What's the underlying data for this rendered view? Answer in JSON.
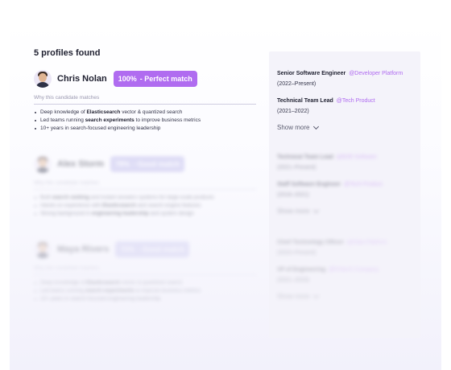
{
  "results": {
    "heading": "5 profiles found"
  },
  "profiles": [
    {
      "name": "Chris Nolan",
      "score": "100%",
      "match_label": "- Perfect match",
      "why_label": "Why this candidate matches",
      "bullets": [
        {
          "pre": "Deep knowledge of ",
          "bold": "Elasticsearch",
          "post": " vector & quantized search"
        },
        {
          "pre": "Led teams running ",
          "bold": "search experiments",
          "post": " to improve business metrics"
        },
        {
          "pre": "10+ years in search-focused engineering leadership",
          "bold": "",
          "post": ""
        }
      ]
    },
    {
      "name": "Alex Storm",
      "score": "78%",
      "match_label": "- Good match",
      "why_label": "Why this candidate matches",
      "bullets": [
        {
          "pre": "Built ",
          "bold": "search ranking",
          "post": " and instant answers systems for large-scale products"
        },
        {
          "pre": "Hands-on experience with ",
          "bold": "Elasticsearch",
          "post": " and search engine features"
        },
        {
          "pre": "Strong background in ",
          "bold": "engineering leadership",
          "post": " and system design"
        }
      ]
    },
    {
      "name": "Maya Rivers",
      "score": "72%",
      "match_label": "- Good match",
      "why_label": "Why this candidate matches",
      "bullets": [
        {
          "pre": "Deep knowledge of ",
          "bold": "Elasticsearch",
          "post": " vector & quantized search"
        },
        {
          "pre": "Led teams running ",
          "bold": "search experiments",
          "post": " to improve business metrics"
        },
        {
          "pre": "10+ years in search-focused engineering leadership",
          "bold": "",
          "post": ""
        }
      ]
    }
  ],
  "experience": [
    {
      "jobs": [
        {
          "title": "Senior Software Engineer",
          "org": "@Developer Platform",
          "years": "(2022–Present)"
        },
        {
          "title": "Technical Team Lead",
          "org": "@Tech Product",
          "years": "(2021–2022)"
        }
      ],
      "show_more": "Show more"
    },
    {
      "jobs": [
        {
          "title": "Technical Team Lead",
          "org": "@B2B Software",
          "years": "(2021–Present)"
        },
        {
          "title": "Staff Software Engineer",
          "org": "@Tech Product",
          "years": "(2018–2021)"
        }
      ],
      "show_more": "Show more"
    },
    {
      "jobs": [
        {
          "title": "Chief Technology Officer",
          "org": "@Data Platform",
          "years": "(2023–Present)"
        },
        {
          "title": "VP of Engineering",
          "org": "@Fintech Company",
          "years": "(2021–2023)"
        }
      ],
      "show_more": "Show more"
    }
  ],
  "colors": {
    "accent": "#b06cf0",
    "badge_muted": "#b8b4ea",
    "panel": "#f4f3fa"
  }
}
